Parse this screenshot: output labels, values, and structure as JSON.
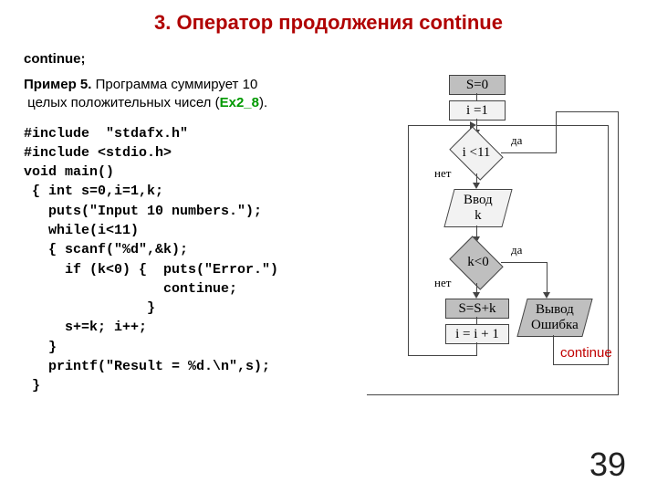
{
  "title": "3. Оператор продолжения continue",
  "syntax": "continue;",
  "example": {
    "label": "Пример 5.",
    "text1": " Программа суммирует 10",
    "text2": "целых положительных чисел (",
    "ref": "Ex2_8",
    "text3": ")."
  },
  "code": "#include  \"stdafx.h\"\n#include <stdio.h>\nvoid main()\n { int s=0,i=1,k;\n   puts(\"Input 10 numbers.\");\n   while(i<11)\n   { scanf(\"%d\",&k);\n     if (k<0) {  puts(\"Error.\")\n                 continue;\n               }\n     s+=k; i++;\n   }\n   printf(\"Result = %d.\\n\",s);\n }",
  "flow": {
    "s0": "S=0",
    "i1": "i =1",
    "cond1": "i  <11",
    "vvod": "Ввод\nk",
    "cond2": "k<0",
    "ssk": "S=S+k",
    "ipp": "i =  i + 1",
    "err": "Вывод\nОшибка",
    "da": "да",
    "net": "нет",
    "cont": "continue"
  },
  "pagenum": "39"
}
